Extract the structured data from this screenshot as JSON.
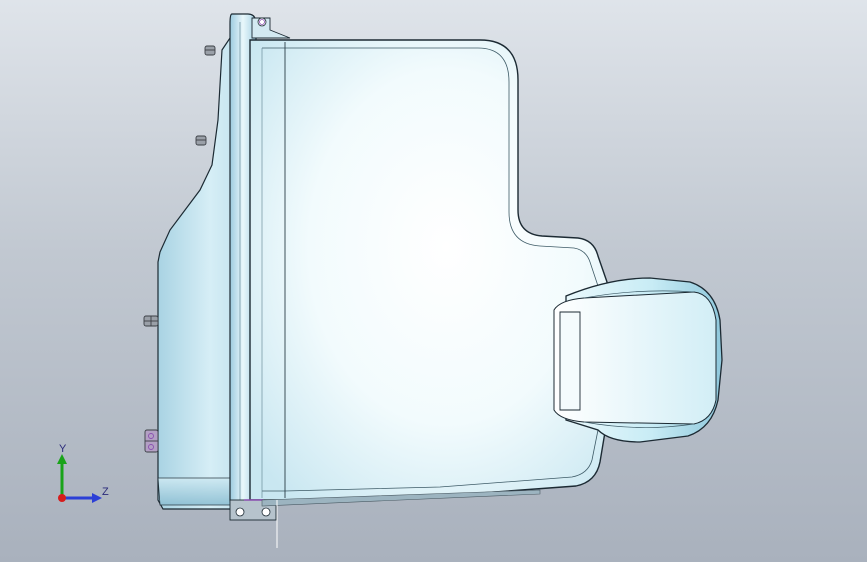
{
  "viewport": {
    "background_top": "#dfe4ea",
    "background_bottom": "#a9b1bd"
  },
  "model": {
    "body_color": "#e6f7fb",
    "body_highlight": "#ffffff",
    "body_shade": "#b9dbe8",
    "edge_color": "#1c2a33",
    "hardware_color": "#5a5f66",
    "accent_color": "#8a4fb0"
  },
  "triad": {
    "y_label": "Y",
    "z_label": "Z",
    "y_color": "#19a319",
    "z_color": "#2b3fd6",
    "x_color": "#d61c1c"
  }
}
